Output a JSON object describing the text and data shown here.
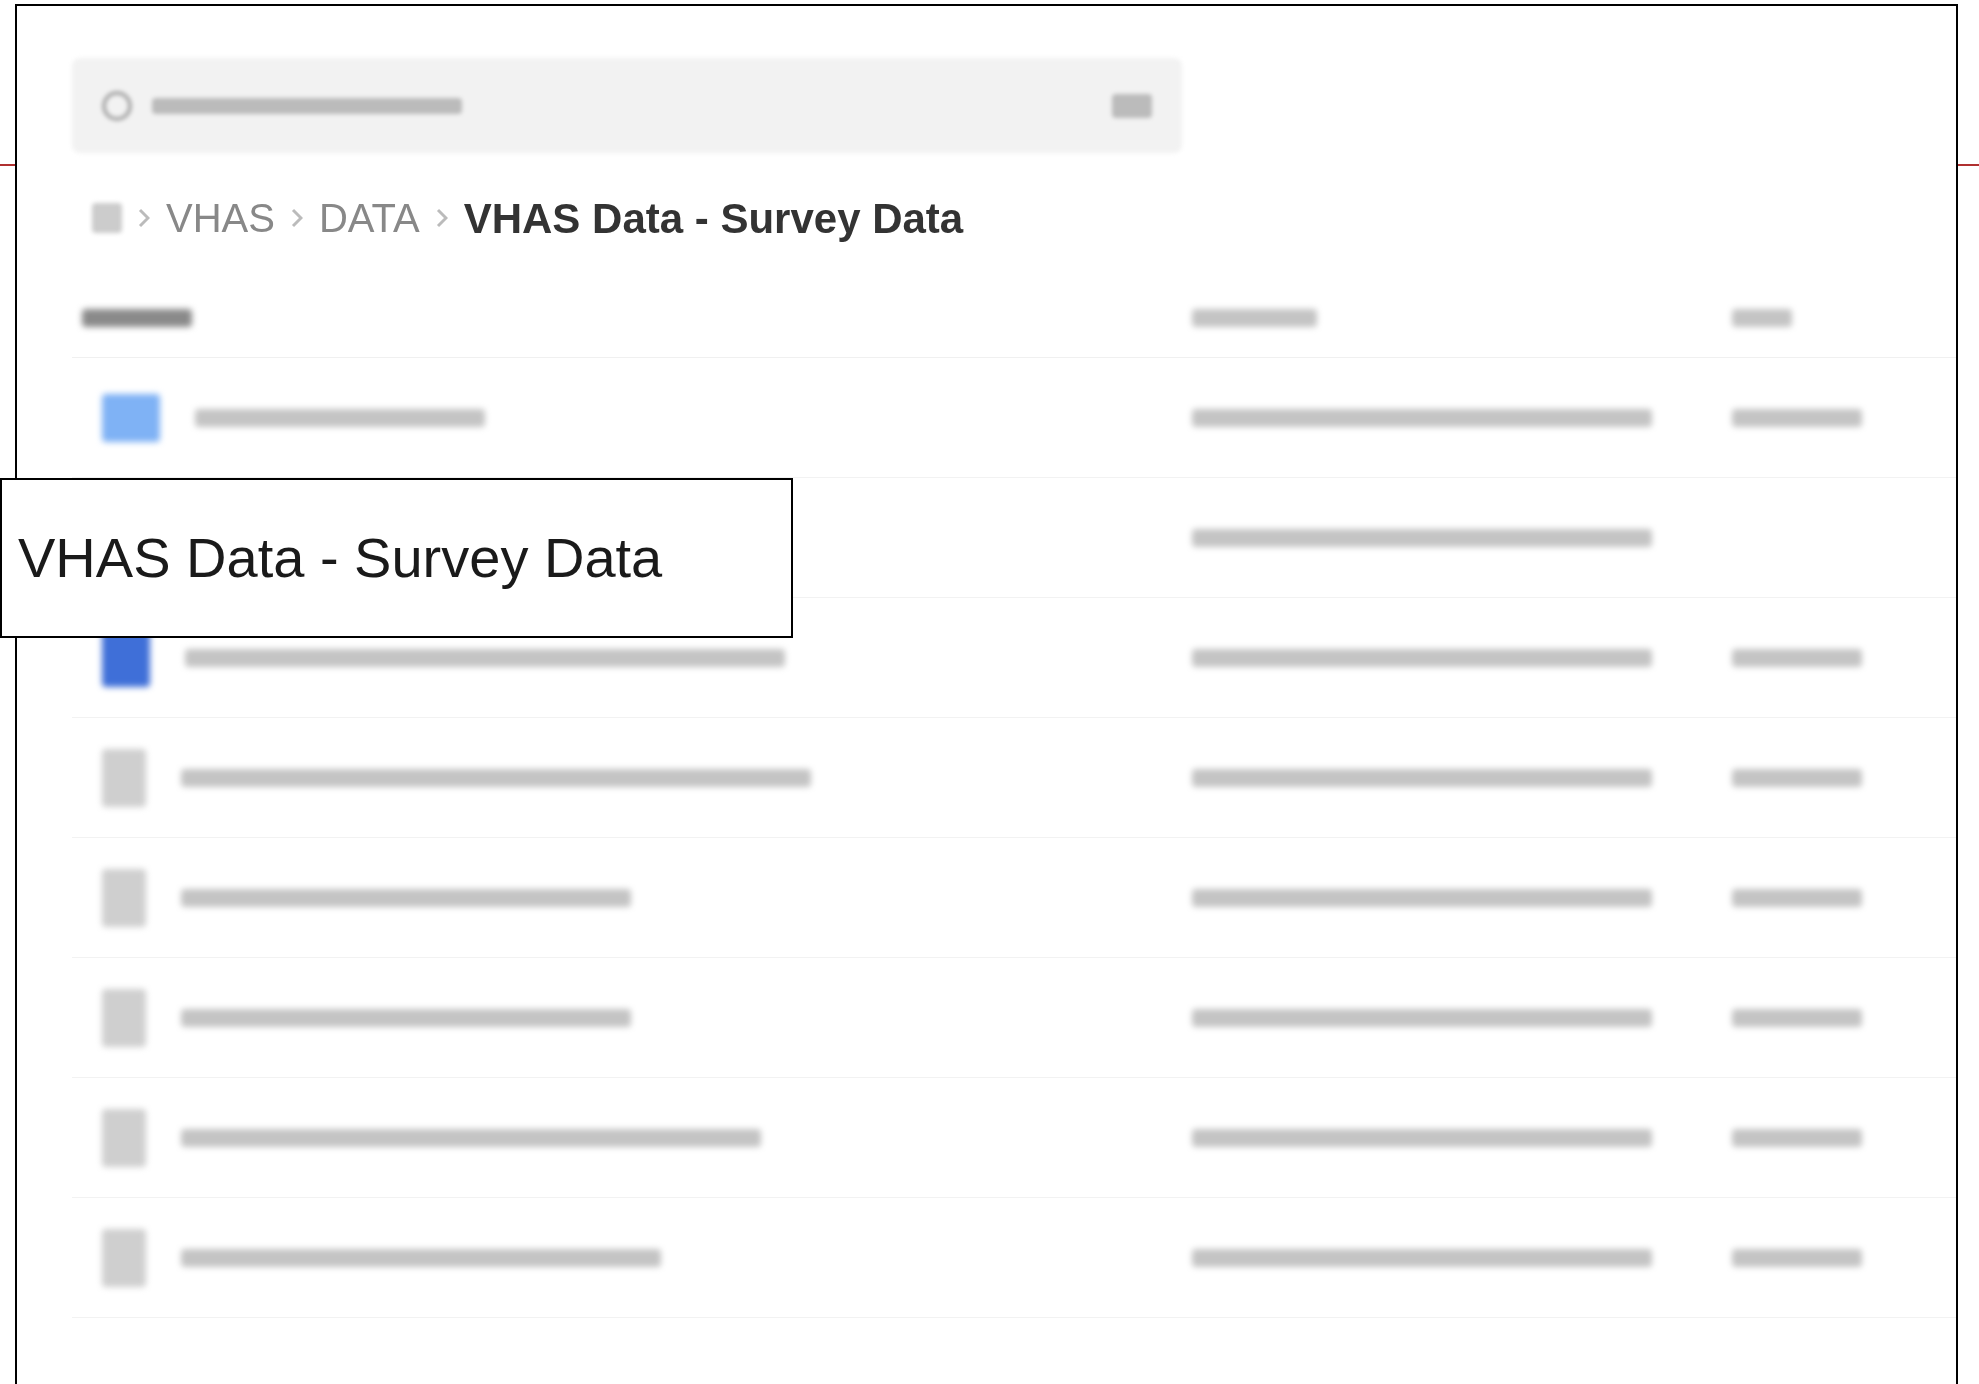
{
  "breadcrumb": [
    {
      "label": "VHAS",
      "current": false
    },
    {
      "label": "DATA",
      "current": false
    },
    {
      "label": "VHAS Data - Survey Data",
      "current": true
    }
  ],
  "rows": [
    {
      "kind": "folder"
    },
    {
      "kind": "hidden"
    },
    {
      "kind": "document"
    },
    {
      "kind": "file"
    },
    {
      "kind": "file"
    },
    {
      "kind": "file"
    },
    {
      "kind": "file"
    },
    {
      "kind": "file"
    }
  ],
  "callout": {
    "text": "VHAS Data - Survey Data"
  }
}
